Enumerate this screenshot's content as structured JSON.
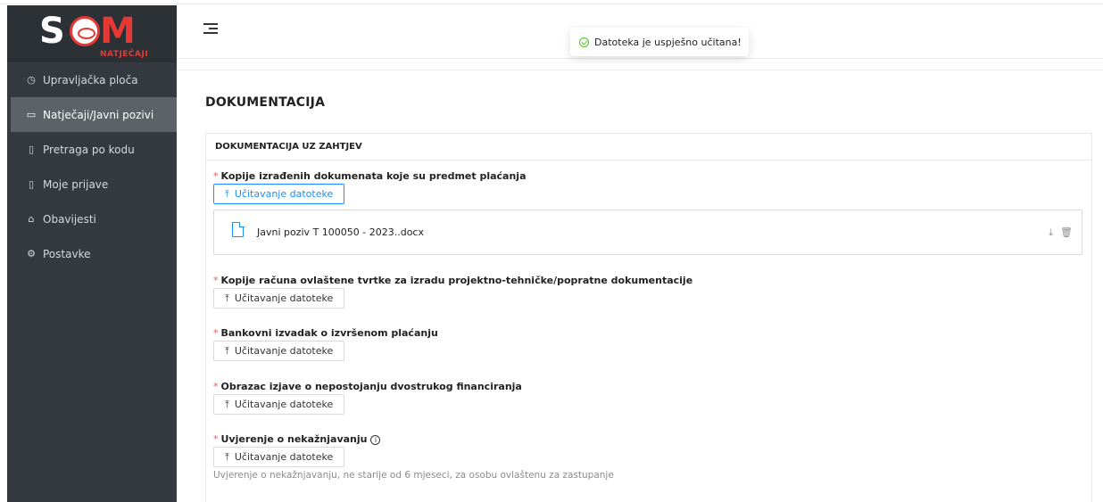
{
  "app": {
    "logo_brand": "SOM",
    "logo_sub": "NATJEČAJI"
  },
  "sidebar": {
    "items": [
      {
        "label": "Upravljačka ploča",
        "icon": "dashboard-icon"
      },
      {
        "label": "Natječaji/Javni pozivi",
        "icon": "folder-open-icon",
        "active": true
      },
      {
        "label": "Pretraga po kodu",
        "icon": "file-icon"
      },
      {
        "label": "Moje prijave",
        "icon": "file-text-icon"
      },
      {
        "label": "Obavijesti",
        "icon": "bell-icon"
      },
      {
        "label": "Postavke",
        "icon": "gear-icon"
      }
    ]
  },
  "toast": {
    "message": "Datoteka je uspješno učitana!",
    "icon": "check-circle-icon",
    "color": "#52c41a"
  },
  "page": {
    "title": "DOKUMENTACIJA"
  },
  "card": {
    "header": "DOKUMENTACIJA UZ ZAHTJEV",
    "required_mark": "*",
    "upload_label": "Učitavanje datoteke",
    "fields": [
      {
        "label": "Kopije izrađenih dokumenata koje su predmet plaćanja",
        "file": "Javni poziv T 100050 - 2023..docx"
      },
      {
        "label": "Kopije računa ovlaštene tvrtke za izradu projektno-tehničke/popratne dokumentacije"
      },
      {
        "label": "Bankovni izvadak o izvršenom plaćanju"
      },
      {
        "label": "Obrazac izjave o nepostojanju dvostrukog financiranja"
      },
      {
        "label": "Uvjerenje o nekažnjavanju",
        "help": "Uvjerenje o nekažnjavanju, ne starije od 6 mjeseci, za osobu ovlaštenu za zastupanje"
      }
    ]
  },
  "colors": {
    "sidebar_bg": "#343a40",
    "sidebar_active": "#5c6268",
    "primary": "#1890ff",
    "required": "#ff4d4f",
    "brand_red": "#e53935"
  }
}
